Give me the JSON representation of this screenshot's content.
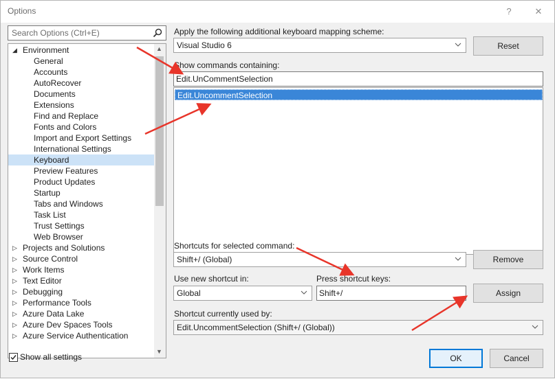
{
  "window": {
    "title": "Options",
    "help_glyph": "?",
    "close_glyph": "✕"
  },
  "search": {
    "placeholder": "Search Options (Ctrl+E)",
    "icon": "search-icon"
  },
  "tree": {
    "items": [
      {
        "label": "Environment",
        "level": 0,
        "expanded": true
      },
      {
        "label": "General",
        "level": 1
      },
      {
        "label": "Accounts",
        "level": 1
      },
      {
        "label": "AutoRecover",
        "level": 1
      },
      {
        "label": "Documents",
        "level": 1
      },
      {
        "label": "Extensions",
        "level": 1
      },
      {
        "label": "Find and Replace",
        "level": 1
      },
      {
        "label": "Fonts and Colors",
        "level": 1
      },
      {
        "label": "Import and Export Settings",
        "level": 1
      },
      {
        "label": "International Settings",
        "level": 1
      },
      {
        "label": "Keyboard",
        "level": 1,
        "selected": true
      },
      {
        "label": "Preview Features",
        "level": 1
      },
      {
        "label": "Product Updates",
        "level": 1
      },
      {
        "label": "Startup",
        "level": 1
      },
      {
        "label": "Tabs and Windows",
        "level": 1
      },
      {
        "label": "Task List",
        "level": 1
      },
      {
        "label": "Trust Settings",
        "level": 1
      },
      {
        "label": "Web Browser",
        "level": 1
      },
      {
        "label": "Projects and Solutions",
        "level": 0,
        "expanded": false
      },
      {
        "label": "Source Control",
        "level": 0,
        "expanded": false
      },
      {
        "label": "Work Items",
        "level": 0,
        "expanded": false
      },
      {
        "label": "Text Editor",
        "level": 0,
        "expanded": false
      },
      {
        "label": "Debugging",
        "level": 0,
        "expanded": false
      },
      {
        "label": "Performance Tools",
        "level": 0,
        "expanded": false
      },
      {
        "label": "Azure Data Lake",
        "level": 0,
        "expanded": false
      },
      {
        "label": "Azure Dev Spaces Tools",
        "level": 0,
        "expanded": false
      },
      {
        "label": "Azure Service Authentication",
        "level": 0,
        "expanded": false
      }
    ]
  },
  "keyboard": {
    "mapping_label": "Apply the following additional keyboard mapping scheme:",
    "mapping_value": "Visual Studio 6",
    "reset_label": "Reset",
    "show_commands_label": "Show commands containing:",
    "show_commands_value": "Edit.UnCommentSelection",
    "commands": [
      "Edit.UncommentSelection"
    ],
    "shortcuts_label": "Shortcuts for selected command:",
    "shortcuts_value": "Shift+/ (Global)",
    "remove_label": "Remove",
    "use_in_label": "Use new shortcut in:",
    "use_in_value": "Global",
    "press_keys_label": "Press shortcut keys:",
    "press_keys_value": "Shift+/",
    "assign_label": "Assign",
    "used_by_label": "Shortcut currently used by:",
    "used_by_value": "Edit.UncommentSelection (Shift+/ (Global))"
  },
  "footer": {
    "show_all_label": "Show all settings",
    "show_all_checked": true,
    "ok_label": "OK",
    "cancel_label": "Cancel"
  },
  "colors": {
    "accent": "#0078d7",
    "selection": "#3a86d8",
    "annotation_arrow": "#e8352a"
  }
}
